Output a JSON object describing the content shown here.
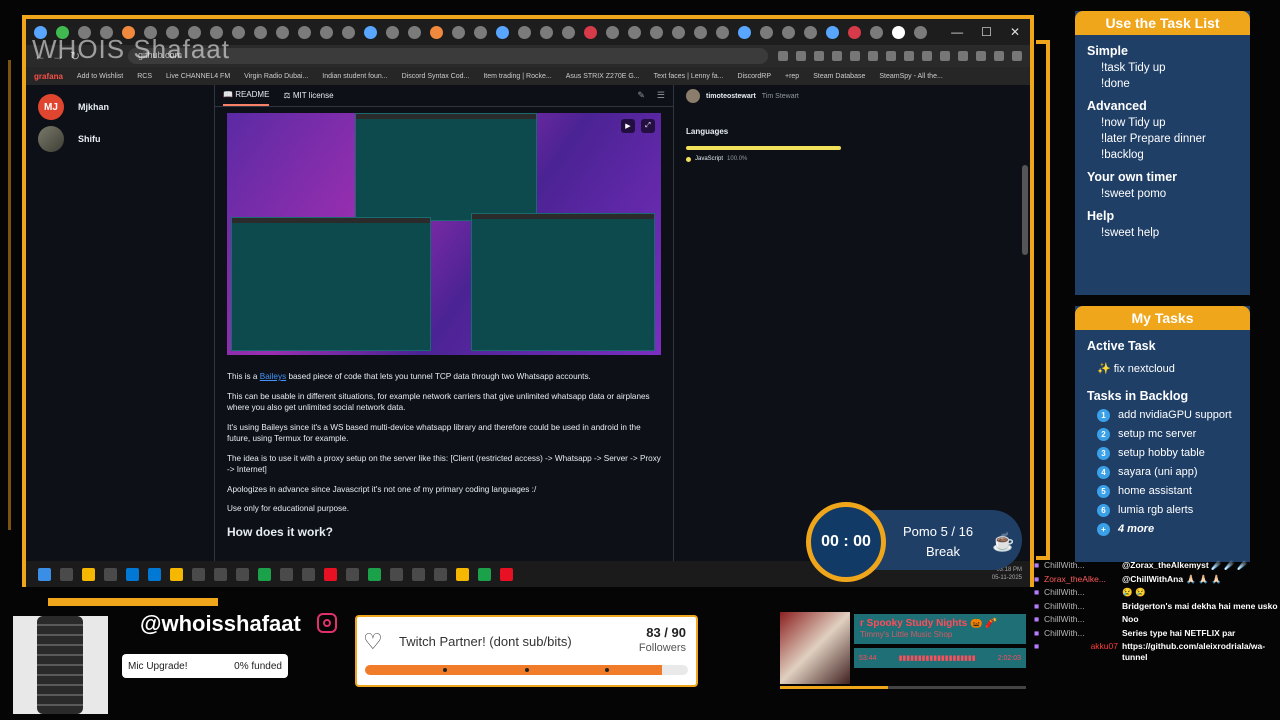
{
  "browser": {
    "url": "github.com",
    "watermark": "WHOIS Shafaat",
    "bookmarks": [
      "grafana",
      "Add to Wishlist",
      "RCS",
      "Live CHANNEL4 FM",
      "Virgin Radio Dubai...",
      "Indian student foun...",
      "Discord Syntax Cod...",
      "Item trading | Rocke...",
      "Asus STRIX Z270E G...",
      "Text faces | Lenny fa...",
      "DiscordRP",
      "+rep",
      "Steam Database",
      "SteamSpy - All the..."
    ],
    "window_controls": [
      "—",
      "☐",
      "✕"
    ]
  },
  "contributors": [
    {
      "initials": "MJ",
      "name": "Mjkhan"
    },
    {
      "initials": "",
      "name": "Shifu"
    }
  ],
  "readme": {
    "tabs": [
      "README",
      "MIT license"
    ],
    "paragraph1_pre": "This is a ",
    "paragraph1_link": "Baileys",
    "paragraph1_post": " based piece of code that lets you tunnel TCP data through two Whatsapp accounts.",
    "paragraph2": "This can be usable in different situations, for example network carriers that give unlimited whatsapp data or airplanes where you also get unlimited social network data.",
    "paragraph3": "It's using Baileys since it's a WS based multi-device whatsapp library and therefore could be used in android in the future, using Termux for example.",
    "paragraph4": "The idea is to use it with a proxy setup on the server like this: [Client (restricted access) -> Whatsapp -> Server -> Proxy -> Internet]",
    "paragraph5": "Apologizes in advance since Javascript it's not one of my primary coding languages :/",
    "paragraph6": "Use only for educational purpose.",
    "heading": "How does it work?"
  },
  "sidebar": {
    "author_user": "timoteostewart",
    "author_name": "Tim Stewart",
    "languages_title": "Languages",
    "language": "JavaScript",
    "language_pct": "100.0%",
    "language_color": "#f1e05a"
  },
  "taskbar": {
    "time": "03:18 PM",
    "date": "05-11-2025"
  },
  "pomodoro": {
    "timer": "00 : 00",
    "count": "Pomo  5  / 16",
    "mode": "Break"
  },
  "task_help": {
    "title": "Use the Task List",
    "sections": [
      {
        "name": "Simple",
        "commands": [
          "!task Tidy up",
          "!done"
        ]
      },
      {
        "name": "Advanced",
        "commands": [
          "!now Tidy up",
          "!later Prepare dinner",
          "!backlog"
        ]
      },
      {
        "name": "Your own timer",
        "commands": [
          "!sweet pomo"
        ]
      },
      {
        "name": "Help",
        "commands": [
          "!sweet help"
        ]
      }
    ]
  },
  "my_tasks": {
    "title": "My Tasks",
    "active_label": "Active Task",
    "active_task": "✨ fix nextcloud",
    "backlog_label": "Tasks in Backlog",
    "backlog": [
      {
        "n": "1",
        "text": "add nvidiaGPU support"
      },
      {
        "n": "2",
        "text": "setup mc server"
      },
      {
        "n": "3",
        "text": "setup hobby table"
      },
      {
        "n": "4",
        "text": "sayara (uni app)"
      },
      {
        "n": "5",
        "text": "home assistant"
      },
      {
        "n": "6",
        "text": "lumia rgb alerts"
      }
    ],
    "more_n": "+",
    "more_text": "4 more"
  },
  "social": {
    "handle": "@whoisshafaat",
    "mic_label": "Mic Upgrade!",
    "mic_funded": "0% funded"
  },
  "partner": {
    "text": "Twitch Partner! (dont sub/bits)",
    "count": "83 / 90",
    "unit": "Followers",
    "progress": 0.92
  },
  "music": {
    "title": "r Spooky Study Nights 🎃 🧨",
    "subtitle": "Timmy's Little Music Shop",
    "elapsed": "53:44",
    "total": "2:02:03",
    "progress": 0.44
  },
  "chat": [
    {
      "user": "ChillWith...",
      "msg": "@Zorax_theAlkemyst ☄️ ☄️ ☄️"
    },
    {
      "user": "Zorax_theAlke...",
      "msg": "@ChillWithAna 🙏🏻 🙏🏻 🙏🏻"
    },
    {
      "user": "ChillWith...",
      "msg": "😢 😢"
    },
    {
      "user": "ChillWith...",
      "msg": "Bridgerton's mai dekha hai mene usko"
    },
    {
      "user": "ChillWith...",
      "msg": "Noo"
    },
    {
      "user": "ChillWith...",
      "msg": "Series type hai NETFLIX par"
    },
    {
      "user": "akku07",
      "msg": "https://github.com/aleixrodriala/wa-tunnel"
    }
  ],
  "colors": {
    "accent": "#f0a61b",
    "panel": "#1f3f67",
    "link": "#4493f8"
  }
}
